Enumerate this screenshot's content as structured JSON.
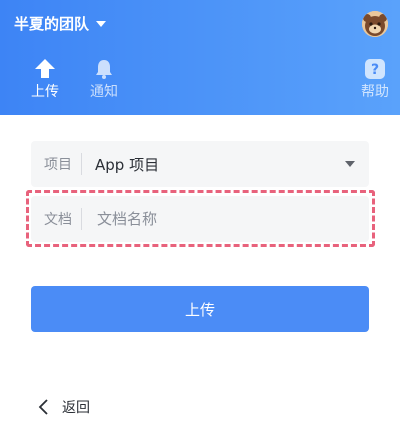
{
  "header": {
    "team_name": "半夏的团队",
    "tabs": [
      {
        "label": "上传",
        "icon": "upload-arrow-icon",
        "active": true
      },
      {
        "label": "通知",
        "icon": "bell-icon",
        "active": false
      }
    ],
    "help": {
      "label": "帮助",
      "icon": "help-icon"
    }
  },
  "form": {
    "project": {
      "label": "项目",
      "value": "App 项目"
    },
    "document": {
      "label": "文档",
      "placeholder": "文档名称",
      "value": ""
    }
  },
  "actions": {
    "submit_label": "上传",
    "back_label": "返回"
  },
  "colors": {
    "header_start": "#3d84f5",
    "header_end": "#5aa2fb",
    "primary_button": "#4b8cf6",
    "highlight_dash": "#e8627c",
    "field_bg": "#f5f6f7"
  }
}
